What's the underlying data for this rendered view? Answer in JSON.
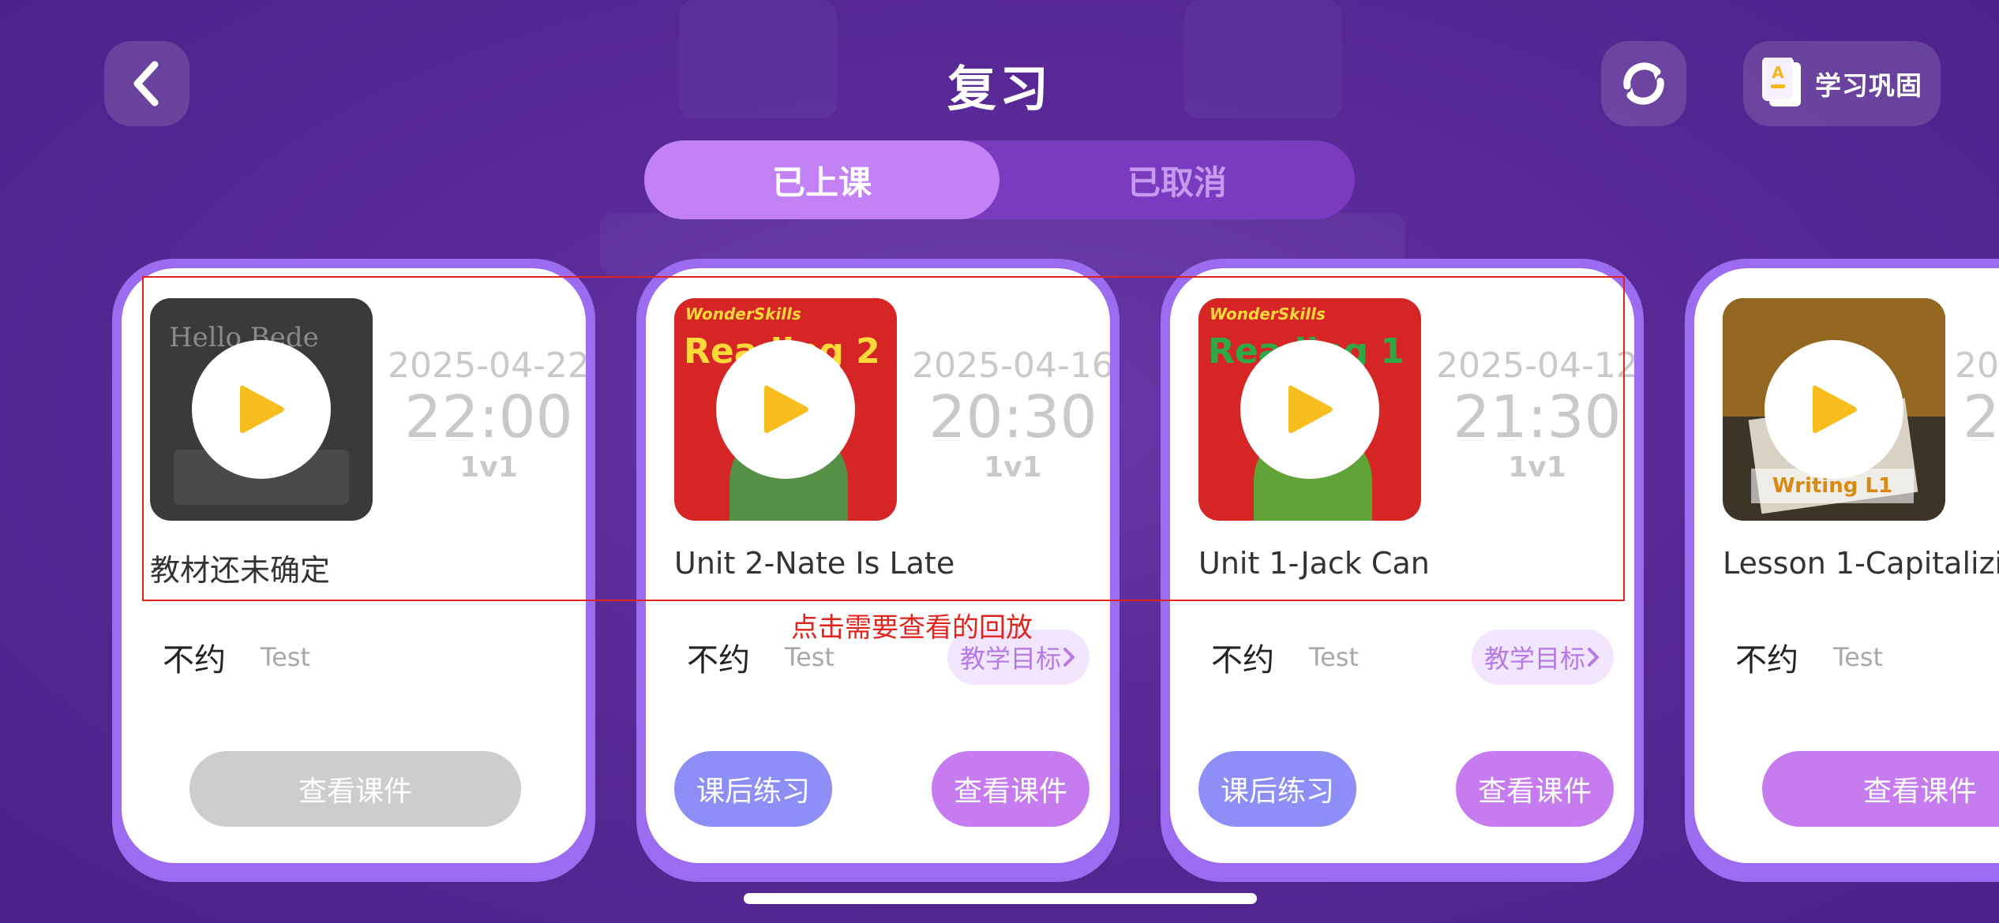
{
  "header": {
    "title": "复习",
    "study_label": "学习巩固"
  },
  "tabs": [
    {
      "label": "已上课",
      "active": true
    },
    {
      "label": "已取消",
      "active": false
    }
  ],
  "cards": [
    {
      "date": "2025-04-22",
      "time": "22:00",
      "type": "1v1",
      "title": "教材还未确定",
      "status": "不约",
      "teacher": "Test",
      "goal_label": "",
      "practice_label": "",
      "courseware_label": "查看课件",
      "thumb_text": "Hello Bede",
      "thumb_color": "#3a3a3a"
    },
    {
      "date": "2025-04-16",
      "time": "20:30",
      "type": "1v1",
      "title": "Unit 2-Nate Is Late",
      "status": "不约",
      "teacher": "Test",
      "goal_label": "教学目标",
      "practice_label": "课后练习",
      "courseware_label": "查看课件",
      "thumb_brand": "WonderSkills",
      "thumb_text": "Reading 2",
      "thumb_color": "#d62525"
    },
    {
      "date": "2025-04-12",
      "time": "21:30",
      "type": "1v1",
      "title": "Unit 1-Jack Can",
      "status": "不约",
      "teacher": "Test",
      "goal_label": "教学目标",
      "practice_label": "课后练习",
      "courseware_label": "查看课件",
      "thumb_brand": "WonderSkills",
      "thumb_text": "Reading 1",
      "thumb_color": "#d62525"
    },
    {
      "date": "20",
      "time": "2",
      "type": "",
      "title": "Lesson 1-Capitalizi",
      "status": "不约",
      "teacher": "Test",
      "goal_label": "",
      "practice_label": "",
      "courseware_label": "查看课件",
      "thumb_text": "Writing L1",
      "thumb_color": "#3d3428"
    }
  ],
  "annotation": "点击需要查看的回放",
  "colors": {
    "background": "#5a2a98",
    "tab_active": "#c281f4",
    "card_border": "#9b6cf0",
    "play_icon": "#f8bd1f",
    "practice_button": "#8d8ef6",
    "courseware_button": "#c67cef",
    "annotation": "#e0231c"
  }
}
